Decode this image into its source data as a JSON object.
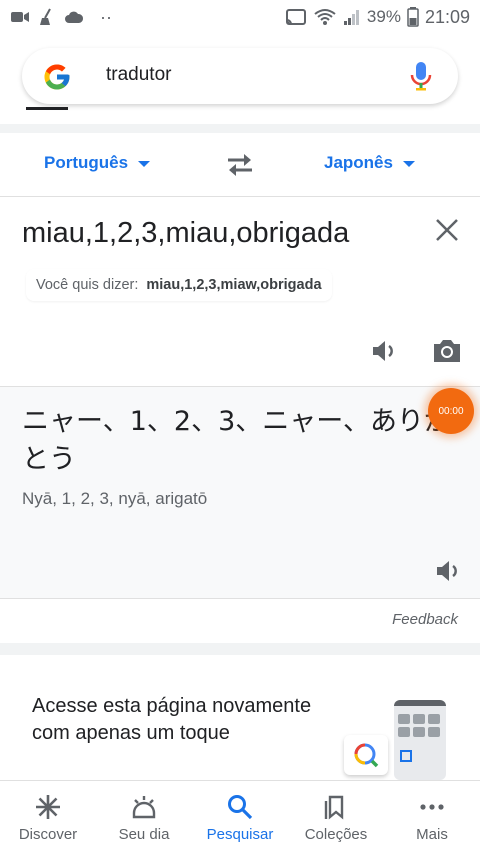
{
  "status_bar": {
    "battery": "39%",
    "time": "21:09",
    "overflow": "··"
  },
  "search": {
    "query": "tradutor"
  },
  "translate": {
    "source_lang": "Português",
    "target_lang": "Japonês",
    "source_text": "miau,1,2,3,miau,obrigada",
    "suggestion_label": "Você quis dizer:",
    "suggestion_value": "miau,1,2,3,miaw,obrigada",
    "translated_text": "ニャー、1、2、3、ニャー、ありがとう",
    "romanization": "Nyā, 1, 2, 3, nyā, arigatō",
    "record_timer": "00:00",
    "feedback": "Feedback"
  },
  "promo": {
    "text": "Acesse esta página novamente com apenas um toque"
  },
  "bottom_nav": {
    "items": [
      {
        "label": "Discover",
        "icon": "asterisk-icon"
      },
      {
        "label": "Seu dia",
        "icon": "sunrise-icon"
      },
      {
        "label": "Pesquisar",
        "icon": "search-icon"
      },
      {
        "label": "Coleções",
        "icon": "bookmarks-icon"
      },
      {
        "label": "Mais",
        "icon": "more-dots-icon"
      }
    ],
    "active_index": 2
  },
  "colors": {
    "accent": "#1a73e8",
    "record": "#f26a10"
  }
}
